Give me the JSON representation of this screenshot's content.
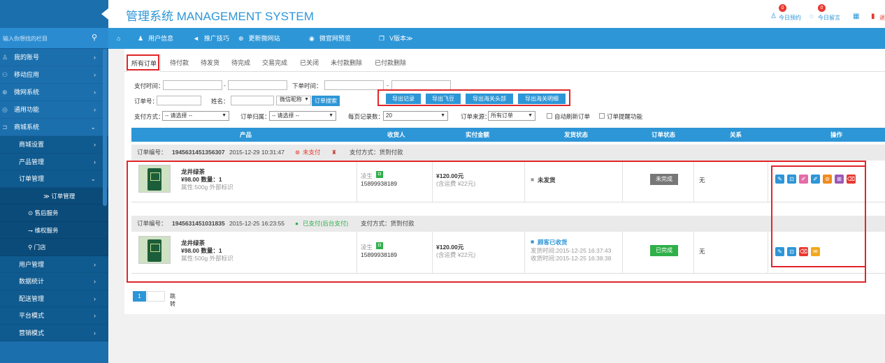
{
  "app_title": "管理系统 MANAGEMENT SYSTEM",
  "header_right": [
    {
      "icon": "user-icon",
      "label": "今日预约",
      "badge": "0"
    },
    {
      "icon": "chat-icon",
      "label": "今日留言",
      "badge": "0"
    },
    {
      "icon": "qrcode-icon",
      "label": "",
      "badge": ""
    },
    {
      "icon": "exit-icon",
      "label": "退",
      "badge": ""
    }
  ],
  "search": {
    "placeholder": "输入你想找的栏目"
  },
  "sidebar": {
    "items": [
      {
        "label": "我的账号",
        "icon": "user-icon"
      },
      {
        "label": "移动应用",
        "icon": "apps-icon"
      },
      {
        "label": "微网系统",
        "icon": "globe-icon"
      },
      {
        "label": "通用功能",
        "icon": "tool-icon"
      },
      {
        "label": "商城系统",
        "icon": "cart-icon"
      }
    ],
    "sub": [
      {
        "label": "商城设置"
      },
      {
        "label": "产品管理"
      },
      {
        "label": "订单管理"
      }
    ],
    "subsub": [
      {
        "label": "≫ 订单管理"
      },
      {
        "label": "⊙ 售后服务"
      },
      {
        "label": "⇁ 维权服务"
      },
      {
        "label": "⚲ 门店"
      }
    ],
    "after": [
      {
        "label": "用户管理"
      },
      {
        "label": "数据统计"
      },
      {
        "label": "配送管理"
      },
      {
        "label": "平台模式"
      },
      {
        "label": "营销模式"
      }
    ]
  },
  "nav": [
    {
      "label": "用户信息",
      "icon": "user-icon"
    },
    {
      "label": "推广技巧",
      "icon": "megaphone-icon"
    },
    {
      "label": "更新微网站",
      "icon": "globe-icon"
    },
    {
      "label": "微官网预览",
      "icon": "eye-icon"
    },
    {
      "label": "V版本≫",
      "icon": "copy-icon"
    }
  ],
  "tabs": [
    "所有订单",
    "待付款",
    "待发货",
    "待完成",
    "交易完成",
    "已关闭",
    "未付款删除",
    "已付款删除"
  ],
  "filters": {
    "pay_time": "支付时间：",
    "order_time": "下单时间：",
    "dash": "-",
    "order_no": "订单号：",
    "name": "姓名：",
    "nickname_select": "微信昵称",
    "search_btn": "订单搜索",
    "pay_method": "支付方式：",
    "pay_method_value": "-- 请选择 --",
    "order_belong": "订单归属：",
    "order_belong_value": "-- 请选择 --",
    "per_page": "每页记录数：",
    "per_page_value": "20",
    "order_source": "订单来源：",
    "order_source_value": "所有订单",
    "auto_refresh": "自动刷新订单",
    "order_remind": "订单提醒功能"
  },
  "export_buttons": [
    "导出记录",
    "导出飞豆",
    "导出海关头部",
    "导出海关明细"
  ],
  "table_headers": [
    "产品",
    "收货人",
    "实付金额",
    "发货状态",
    "订单状态",
    "关系",
    "操作"
  ],
  "orders": [
    {
      "order_no_label": "订单编号：",
      "order_no": "1945631451356307",
      "time": "2015-12-29 10:31:47",
      "pay_status": "未支付",
      "pay_method": "支付方式：货到付款",
      "product_name": "龙井绿茶",
      "price_qty_prefix": "¥98.00 数量：",
      "qty": "1",
      "attr": "属性:500g 外部标识",
      "receiver": "凌生",
      "phone": "15899938189",
      "amount": "¥120.00元",
      "shipping": "(含运费 ¥22元)",
      "ship_status": "未发货",
      "ship_time": "",
      "recv_time": "",
      "order_status": "未完成",
      "relation": "无",
      "ops": [
        {
          "icon": "edit-icon",
          "color": "#2d96d7"
        },
        {
          "icon": "view-icon",
          "color": "#2d96d7"
        },
        {
          "icon": "pen-icon",
          "color": "#e46aa8"
        },
        {
          "icon": "pen-icon",
          "color": "#2d96d7"
        },
        {
          "icon": "ban-icon",
          "color": "#f08c1f"
        },
        {
          "icon": "car-icon",
          "color": "#9b59b6"
        },
        {
          "icon": "trash-icon",
          "color": "#e8382f"
        }
      ]
    },
    {
      "order_no_label": "订单编号：",
      "order_no": "1945631451031835",
      "time": "2015-12-25 16:23:55",
      "pay_status": "已支付(后台支付)",
      "pay_method": "支付方式：货到付款",
      "product_name": "龙井绿茶",
      "price_qty_prefix": "¥98.00 数量：",
      "qty": "1",
      "attr": "属性:500g 外部标识",
      "receiver": "凌生",
      "phone": "15899938189",
      "amount": "¥120.00元",
      "shipping": "(含运费 ¥22元)",
      "ship_status": "顾客已收货",
      "ship_time": "发货时间:2015-12-25 16:37:43",
      "recv_time": "收货时间:2015-12-25 16:38:38",
      "order_status": "已完成",
      "relation": "无",
      "ops": [
        {
          "icon": "edit-icon",
          "color": "#2d96d7"
        },
        {
          "icon": "view-icon",
          "color": "#2d96d7"
        },
        {
          "icon": "trash-icon",
          "color": "#e8382f"
        },
        {
          "icon": "note-icon",
          "color": "#f0a81f"
        }
      ]
    }
  ],
  "pager": {
    "current": "1",
    "jump": "跳转"
  },
  "colors": {
    "primary": "#2d96d7",
    "sidebar": "#1b6fad",
    "red": "#e8382f",
    "green": "#2fb04a"
  }
}
